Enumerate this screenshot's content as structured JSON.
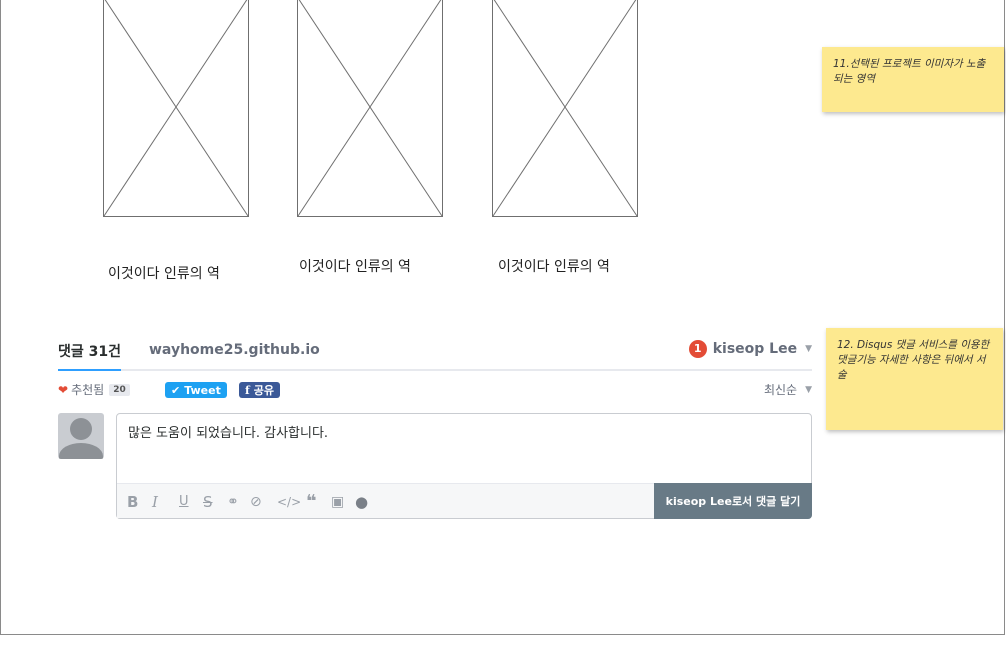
{
  "placeholders": {
    "captions": [
      "이것이다 인류의 역",
      "이것이다 인류의 역",
      "이것이다 인류의 역"
    ]
  },
  "notes": {
    "note_11": "11.선택된 프로젝트 이미자가 노출되는 영역",
    "note_12": "12. Disqus 댓글 서비스를 이용한 댓글기능 자세한 사항은 뒤에서 서술"
  },
  "disqus": {
    "comment_count": "댓글 31건",
    "site_name": "wayhome25.github.io",
    "notification_count": "1",
    "username": "kiseop Lee",
    "recommend_label": "추천됨",
    "recommend_count": "20",
    "tweet_label": "Tweet",
    "share_label": "공유",
    "sort_label": "최신순",
    "comment_text": "많은 도움이 되었습니다. 감사합니다.",
    "post_button_label": "kiseop Lee로서 댓글 달기",
    "format_buttons": [
      "B",
      "I",
      "U",
      "S",
      "link",
      "spoiler",
      "code",
      "quote",
      "image",
      "gif"
    ]
  },
  "colors": {
    "accent": "#2e9fff",
    "heart": "#e34c36",
    "tweet": "#1da1f2",
    "facebook": "#3b5998",
    "post_button": "#687a86",
    "sticky_note": "#fde98f"
  }
}
